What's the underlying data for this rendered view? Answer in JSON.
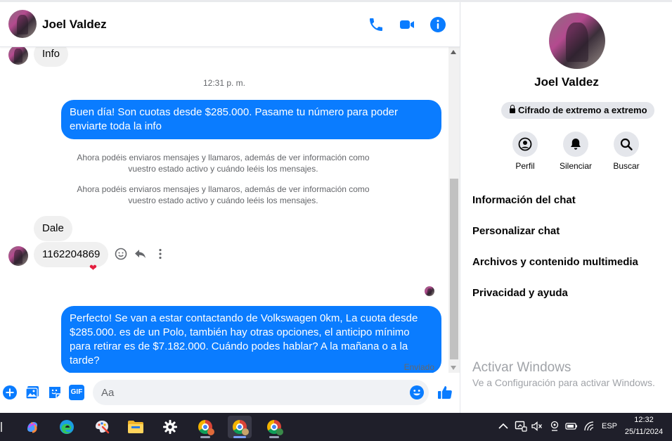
{
  "chat": {
    "contact_name": "Joel Valdez",
    "messages": {
      "info_bubble": "Info",
      "time": "12:31 p. m.",
      "out1": "Buen día! Son cuotas desde $285.000. Pasame tu número para poder enviarte toda la info",
      "sys1": "Ahora podéis enviaros mensajes y llamaros, además de ver información como vuestro estado activo y cuándo leéis los mensajes.",
      "sys2": "Ahora podéis enviaros mensajes y llamaros, además de ver información como vuestro estado activo y cuándo leéis los mensajes.",
      "in_dale": "Dale",
      "in_number": "1162204869",
      "reaction": "❤",
      "out2": "Perfecto!  Se van a estar contactando de Volkswagen 0km, La cuota desde $285.000. es de un Polo, también hay otras opciones, el anticipo mínimo para retirar es de $7.182.000. Cuándo podes hablar? A la mañana o a la tarde?",
      "status": "Enviado"
    },
    "composer": {
      "placeholder": "Aa",
      "gif_label": "GIF"
    },
    "colors": {
      "accent": "#0a7cff",
      "bubble_in": "#f0f0f0"
    }
  },
  "info_panel": {
    "name": "Joel Valdez",
    "encryption": "Cifrado de extremo a extremo",
    "actions": [
      "Perfil",
      "Silenciar",
      "Buscar"
    ],
    "menu": [
      "Información del chat",
      "Personalizar chat",
      "Archivos y contenido multimedia",
      "Privacidad y ayuda"
    ],
    "watermark_title": "Activar Windows",
    "watermark_sub": "Ve a Configuración para activar Windows."
  },
  "taskbar": {
    "language": "ESP",
    "time": "12:32",
    "date": "25/11/2024",
    "apps": [
      "copilot-icon",
      "edge-icon",
      "paint-icon",
      "file-explorer-icon",
      "settings-icon",
      "chrome-icon",
      "chrome-icon",
      "chrome-icon"
    ]
  }
}
